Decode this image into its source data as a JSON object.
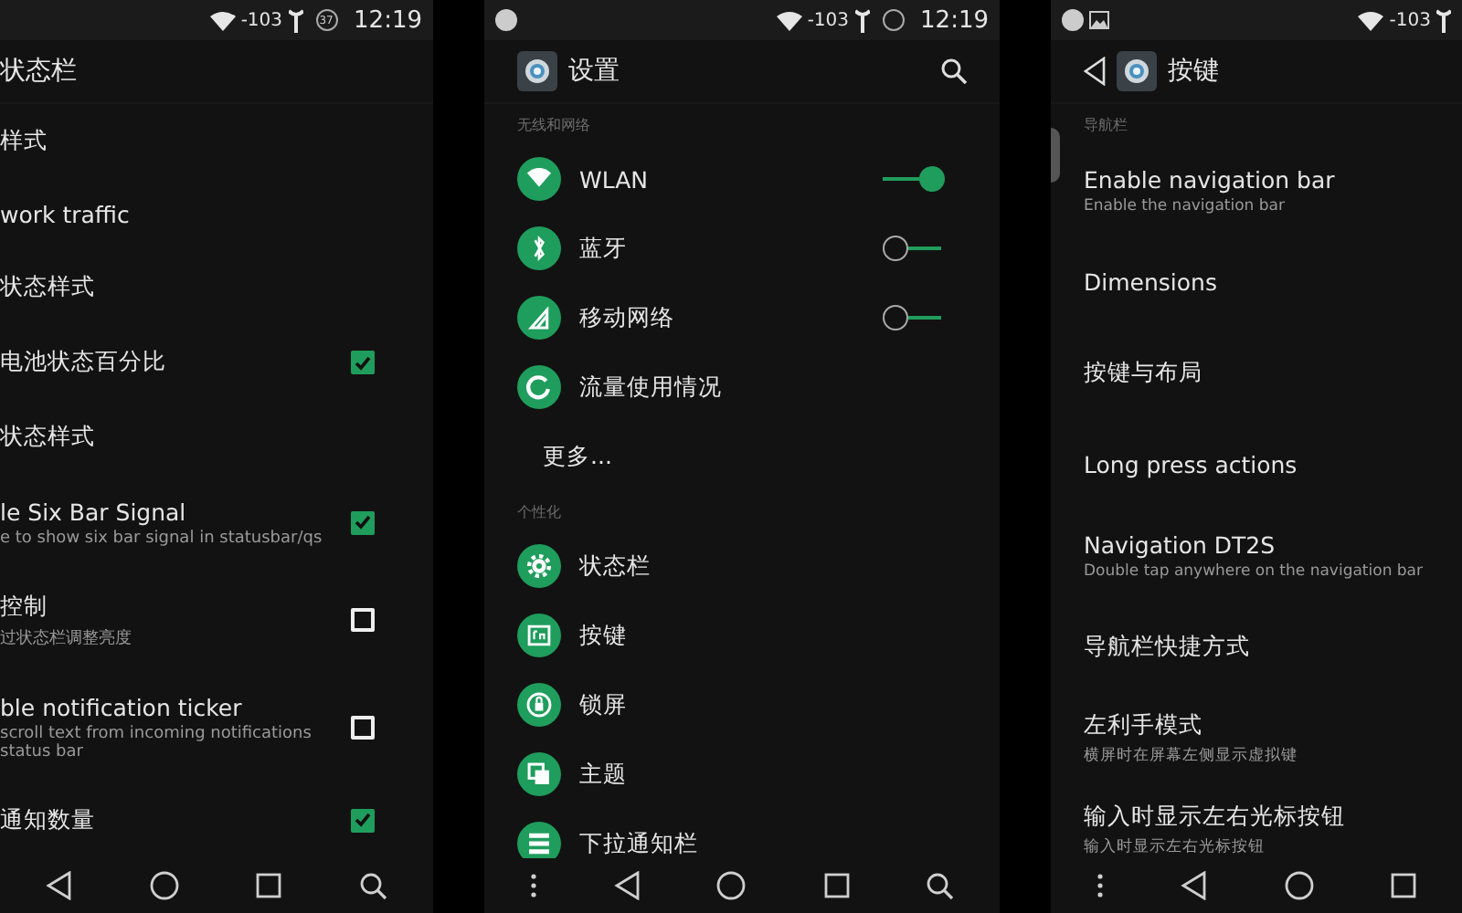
{
  "screens": [
    {
      "status_bar": {
        "signal": "-103",
        "battery": "37",
        "time": "12:19"
      },
      "toolbar": {
        "title": "状态栏"
      },
      "items": [
        {
          "kind": "row",
          "title": "样式"
        },
        {
          "kind": "row",
          "title": "work traffic"
        },
        {
          "kind": "row",
          "title": "状态样式"
        },
        {
          "kind": "row",
          "title": "电池状态百分比",
          "checked": true
        },
        {
          "kind": "row",
          "title": "状态样式"
        },
        {
          "kind": "row",
          "title": "le Six Bar Signal",
          "summary": "e to show six bar signal in statusbar/qs",
          "checked": true
        },
        {
          "kind": "row",
          "title": "控制",
          "summary": "过状态栏调整亮度",
          "checked": false
        },
        {
          "kind": "row",
          "title": "ble notification ticker",
          "summary": "scroll text from incoming notifications\nstatus bar",
          "checked": false
        },
        {
          "kind": "row",
          "title": "通知数量",
          "checked": true
        }
      ],
      "nav_bar": {
        "buttons": [
          {
            "kind": "back"
          },
          {
            "kind": "home"
          },
          {
            "kind": "recents"
          },
          {
            "kind": "search"
          }
        ]
      }
    },
    {
      "status_bar": {
        "notification_icons": [
          {
            "kind": "dot"
          }
        ],
        "signal": "-103",
        "battery_icon": {
          "kind": "ring"
        },
        "time": "12:19"
      },
      "toolbar": {
        "leading": [
          {
            "kind": "app-icon"
          }
        ],
        "title": "设置",
        "actions": [
          {
            "kind": "search"
          }
        ]
      },
      "items": [
        {
          "kind": "section",
          "title": "无线和网络"
        },
        {
          "kind": "icon-row",
          "title": "WLAN",
          "on": true
        },
        {
          "kind": "icon-row",
          "title": "蓝牙",
          "on": false
        },
        {
          "kind": "icon-row",
          "title": "移动网络",
          "on": false
        },
        {
          "kind": "icon-row",
          "title": "流量使用情况"
        },
        {
          "kind": "plain-row",
          "title": "更多..."
        },
        {
          "kind": "section",
          "title": "个性化"
        },
        {
          "kind": "icon-row",
          "title": "状态栏"
        },
        {
          "kind": "icon-row",
          "title": "按键"
        },
        {
          "kind": "icon-row",
          "title": "锁屏"
        },
        {
          "kind": "icon-row",
          "title": "主题"
        },
        {
          "kind": "icon-row",
          "title": "下拉通知栏"
        }
      ],
      "nav_bar": {
        "buttons": [
          {
            "kind": "menu"
          },
          {
            "kind": "back"
          },
          {
            "kind": "home"
          },
          {
            "kind": "recents"
          },
          {
            "kind": "search"
          }
        ]
      }
    },
    {
      "status_bar": {
        "notification_icons": [
          {
            "kind": "dot"
          },
          {
            "kind": "image"
          }
        ],
        "signal": "-103"
      },
      "toolbar": {
        "leading": [
          {
            "kind": "back"
          },
          {
            "kind": "app-icon"
          }
        ],
        "title": "按键"
      },
      "items": [
        {
          "kind": "section",
          "title": "导航栏"
        },
        {
          "kind": "row",
          "title": "Enable navigation bar",
          "summary": "Enable the navigation bar"
        },
        {
          "kind": "row",
          "title": "Dimensions"
        },
        {
          "kind": "row",
          "title": "按键与布局"
        },
        {
          "kind": "row",
          "title": "Long press actions"
        },
        {
          "kind": "row",
          "title": "Navigation DT2S",
          "summary": "Double tap anywhere on the navigation bar"
        },
        {
          "kind": "row",
          "title": "导航栏快捷方式"
        },
        {
          "kind": "row",
          "title": "左利手模式",
          "summary": "横屏时在屏幕左侧显示虚拟键"
        },
        {
          "kind": "row",
          "title": "输入时显示左右光标按钮",
          "summary": "输入时显示左右光标按钮"
        }
      ],
      "nav_bar": {
        "buttons": [
          {
            "kind": "menu"
          },
          {
            "kind": "back"
          },
          {
            "kind": "home"
          },
          {
            "kind": "recents"
          }
        ]
      }
    }
  ]
}
